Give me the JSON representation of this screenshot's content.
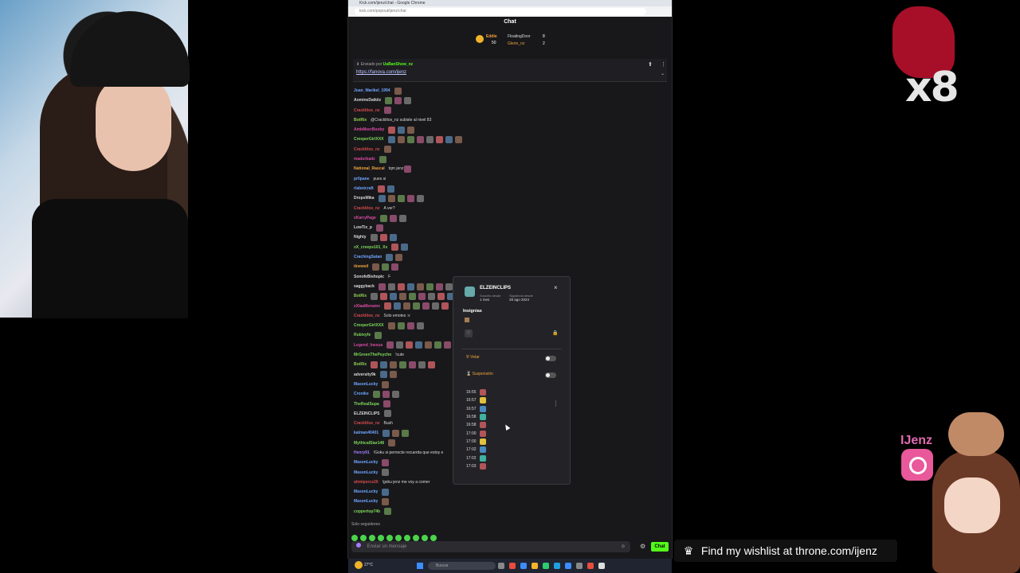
{
  "browser": {
    "window_title": "Kick.com/ijenz/chat - Google Chrome",
    "url": "kick.com/popout/ijenz/chat"
  },
  "chat": {
    "title": "Chat",
    "leaderboard": [
      {
        "name": "Eddie",
        "value": "50"
      },
      {
        "name": "FloatingDoor",
        "value": "8"
      },
      {
        "name": "Glenn_nz",
        "value": "2"
      }
    ],
    "pinned": {
      "sent_by_label": "Enviado por",
      "sender": "UaBanShow_nz",
      "link": "https://fanova.com/ijenz"
    },
    "messages": [
      {
        "name": "Juan_Marikel_1994",
        "color": "#6ea5ff",
        "text": "",
        "emotes": 1
      },
      {
        "name": "AomineDaikiiz",
        "color": "#d7d7d7",
        "text": "",
        "emotes": 3
      },
      {
        "name": "Cracklitos_nz",
        "color": "#d94a4a",
        "text": "",
        "emotes": 1
      },
      {
        "name": "BotRix",
        "color": "#8fd14f",
        "text": "@Cracklitos_nz subiste al nivel 83",
        "emotes": 0
      },
      {
        "name": "AmbMeerBooby",
        "color": "#d94aa0",
        "text": "",
        "emotes": 3
      },
      {
        "name": "CreeperGirlXXX",
        "color": "#7ed957",
        "text": "",
        "emotes": 8
      },
      {
        "name": "Cracklitos_nz",
        "color": "#d94a4a",
        "text": "",
        "emotes": 1
      },
      {
        "name": "madurbadz",
        "color": "#d94aa0",
        "text": "",
        "emotes": 1
      },
      {
        "name": "National_Rascal",
        "color": "#f0a33a",
        "text": "tqm jenz",
        "emotes": 1
      },
      {
        "name": "pr0pane",
        "color": "#6ea5ff",
        "text": "pues si",
        "emotes": 0
      },
      {
        "name": "rlabotcraft",
        "color": "#6ea5ff",
        "text": "",
        "emotes": 2
      },
      {
        "name": "DropsMika",
        "color": "#d7d7d7",
        "text": "",
        "emotes": 5
      },
      {
        "name": "Cracklitos_nz",
        "color": "#d94a4a",
        "text": "A ver?",
        "emotes": 0
      },
      {
        "name": "xKarryPage",
        "color": "#d94aa0",
        "text": "",
        "emotes": 3
      },
      {
        "name": "LowTix_p",
        "color": "#d7d7d7",
        "text": "",
        "emotes": 1
      },
      {
        "name": "Nighty",
        "color": "#d7d7d7",
        "text": "",
        "emotes": 3
      },
      {
        "name": "xX_creeps101_Xx",
        "color": "#7ed957",
        "text": "",
        "emotes": 2
      },
      {
        "name": "CrachingSatan",
        "color": "#6ea5ff",
        "text": "",
        "emotes": 2
      },
      {
        "name": "tinewsil",
        "color": "#f0a33a",
        "text": "",
        "emotes": 3
      },
      {
        "name": "SonofeBishopic",
        "color": "#d7d7d7",
        "text": "F",
        "emotes": 0
      },
      {
        "name": "saggyback",
        "color": "#d7d7d7",
        "text": "",
        "emotes": 9
      },
      {
        "name": "BotRix",
        "color": "#8fd14f",
        "text": "",
        "emotes": 9
      },
      {
        "name": "xXlaaMenamx",
        "color": "#d94aa0",
        "text": "",
        "emotes": 7
      },
      {
        "name": "Cracklitos_nz",
        "color": "#d94a4a",
        "text": "Solo emotes :v",
        "emotes": 0
      },
      {
        "name": "CreeperGirlXXX",
        "color": "#7ed957",
        "text": "",
        "emotes": 4
      },
      {
        "name": "Rubixyfe",
        "color": "#7ed957",
        "text": "",
        "emotes": 1
      },
      {
        "name": "Legend_Inesus",
        "color": "#d94aa0",
        "text": "",
        "emotes": 7
      },
      {
        "name": "MrGreenThePsycho",
        "color": "#7ed957",
        "text": "!cute",
        "emotes": 0
      },
      {
        "name": "BotRix",
        "color": "#8fd14f",
        "text": "",
        "emotes": 7
      },
      {
        "name": "adversity9k",
        "color": "#d7d7d7",
        "text": "",
        "emotes": 2
      },
      {
        "name": "MasonLucky",
        "color": "#6ea5ff",
        "text": "",
        "emotes": 1
      },
      {
        "name": "Cronike",
        "color": "#6ea5ff",
        "text": "",
        "emotes": 3
      },
      {
        "name": "TheRealSupa",
        "color": "#7ed957",
        "text": "",
        "emotes": 1
      },
      {
        "name": "ELZEINCLIPS",
        "color": "#d7d7d7",
        "text": "",
        "emotes": 1
      },
      {
        "name": "Cracklitos_nz",
        "color": "#d94a4a",
        "text": "Bush",
        "emotes": 0
      },
      {
        "name": "kalman40401",
        "color": "#6ea5ff",
        "text": "",
        "emotes": 3
      },
      {
        "name": "MythicalStar148",
        "color": "#7ed957",
        "text": "",
        "emotes": 1
      },
      {
        "name": "Henry91",
        "color": "#a47cff",
        "text": "!Goku si pernocte recuerda que estoy e",
        "emotes": 0
      },
      {
        "name": "MasonLucky",
        "color": "#6ea5ff",
        "text": "",
        "emotes": 1
      },
      {
        "name": "MasonLucky",
        "color": "#6ea5ff",
        "text": "",
        "emotes": 1
      },
      {
        "name": "ahmipercs20",
        "color": "#d94a4a",
        "text": "!goku jenz me voy a comer",
        "emotes": 0
      },
      {
        "name": "MasonLucky",
        "color": "#6ea5ff",
        "text": "",
        "emotes": 1
      },
      {
        "name": "MasonLucky",
        "color": "#6ea5ff",
        "text": "",
        "emotes": 1
      },
      {
        "name": "coppertop74b",
        "color": "#7ed957",
        "text": "",
        "emotes": 1
      }
    ],
    "followers_only": "Solo seguidores",
    "input_placeholder": "Enviar un mensaje",
    "send_label": "Chat"
  },
  "popup": {
    "username": "ELZEINCLIPS",
    "subscribed_label": "Suscrito desde",
    "subscribed_value": "1 mes",
    "following_label": "Siguiendo desde",
    "following_value": "28 ago 2024",
    "badges_label": "Insignias",
    "ban_label": "Vetar",
    "timeout_label": "Suspensión",
    "history_times": [
      "16:55",
      "16:57",
      "16:57",
      "16:58",
      "16:58",
      "17:00",
      "17:00",
      "17:02",
      "17:02",
      "17:03"
    ],
    "close_glyph": "×"
  },
  "taskbar": {
    "weather": "27°C",
    "search_placeholder": "Buscar"
  },
  "overlay": {
    "multiplier": "x8",
    "streamer_handle": "IJenz",
    "wishlist_text": "Find my wishlist at throne.com/ijenz"
  }
}
